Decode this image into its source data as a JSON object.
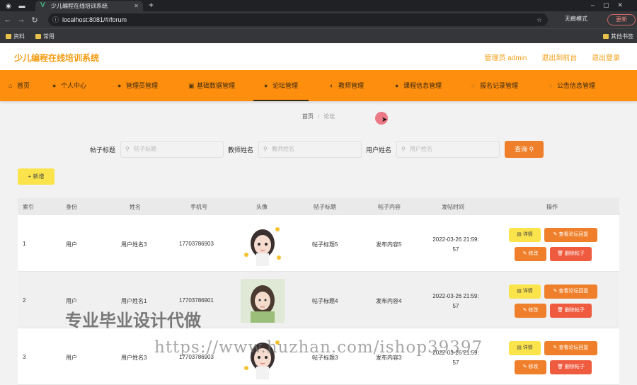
{
  "browser": {
    "tab_title": "少儿编程在线培训系统",
    "url": "localhost:8081/#/forum",
    "incognito_label": "无痕模式",
    "update_label": "更新",
    "bookmarks": [
      "资料",
      "常用"
    ],
    "other_bookmarks": "其他书签"
  },
  "header": {
    "title": "少儿编程在线培训系统",
    "links": [
      "管理员 admin",
      "退出到前台",
      "退出登录"
    ]
  },
  "menu": {
    "items": [
      "首页",
      "个人中心",
      "管理员管理",
      "基础数据管理",
      "论坛管理",
      "教师管理",
      "课程信息管理",
      "报名记录管理",
      "公告信息管理"
    ],
    "active_index": 4
  },
  "breadcrumb": {
    "home": "首页",
    "current": "论坛"
  },
  "search": {
    "fields": [
      {
        "label": "帖子标题",
        "placeholder": "帖子标题"
      },
      {
        "label": "教师姓名",
        "placeholder": "教师姓名"
      },
      {
        "label": "用户姓名",
        "placeholder": "用户姓名"
      }
    ],
    "query_label": "查询"
  },
  "add_label": "+ 新增",
  "table": {
    "columns": [
      "索引",
      "身份",
      "姓名",
      "手机号",
      "头像",
      "帖子标题",
      "帖子内容",
      "发帖时间",
      "操作"
    ],
    "rows": [
      {
        "index": "1",
        "role": "用户",
        "name": "用户姓名3",
        "phone": "17703786903",
        "title": "帖子标题5",
        "content": "发布内容5",
        "time1": "2022-03-26 21:59:",
        "time2": "57"
      },
      {
        "index": "2",
        "role": "用户",
        "name": "用户姓名1",
        "phone": "17703786901",
        "title": "帖子标题4",
        "content": "发布内容4",
        "time1": "2022-03-26 21:59:",
        "time2": "57"
      },
      {
        "index": "3",
        "role": "用户",
        "name": "用户姓名3",
        "phone": "17703786903",
        "title": "帖子标题3",
        "content": "发布内容3",
        "time1": "2022-03-26 21:59:",
        "time2": "57"
      }
    ],
    "actions": {
      "detail": "详情",
      "reply": "查看论坛回复",
      "edit": "修改",
      "delete": "删除帖子"
    }
  },
  "watermarks": {
    "line1": "专业毕业设计代做",
    "line2": "https://www.huzhan.com/ishop39397"
  }
}
